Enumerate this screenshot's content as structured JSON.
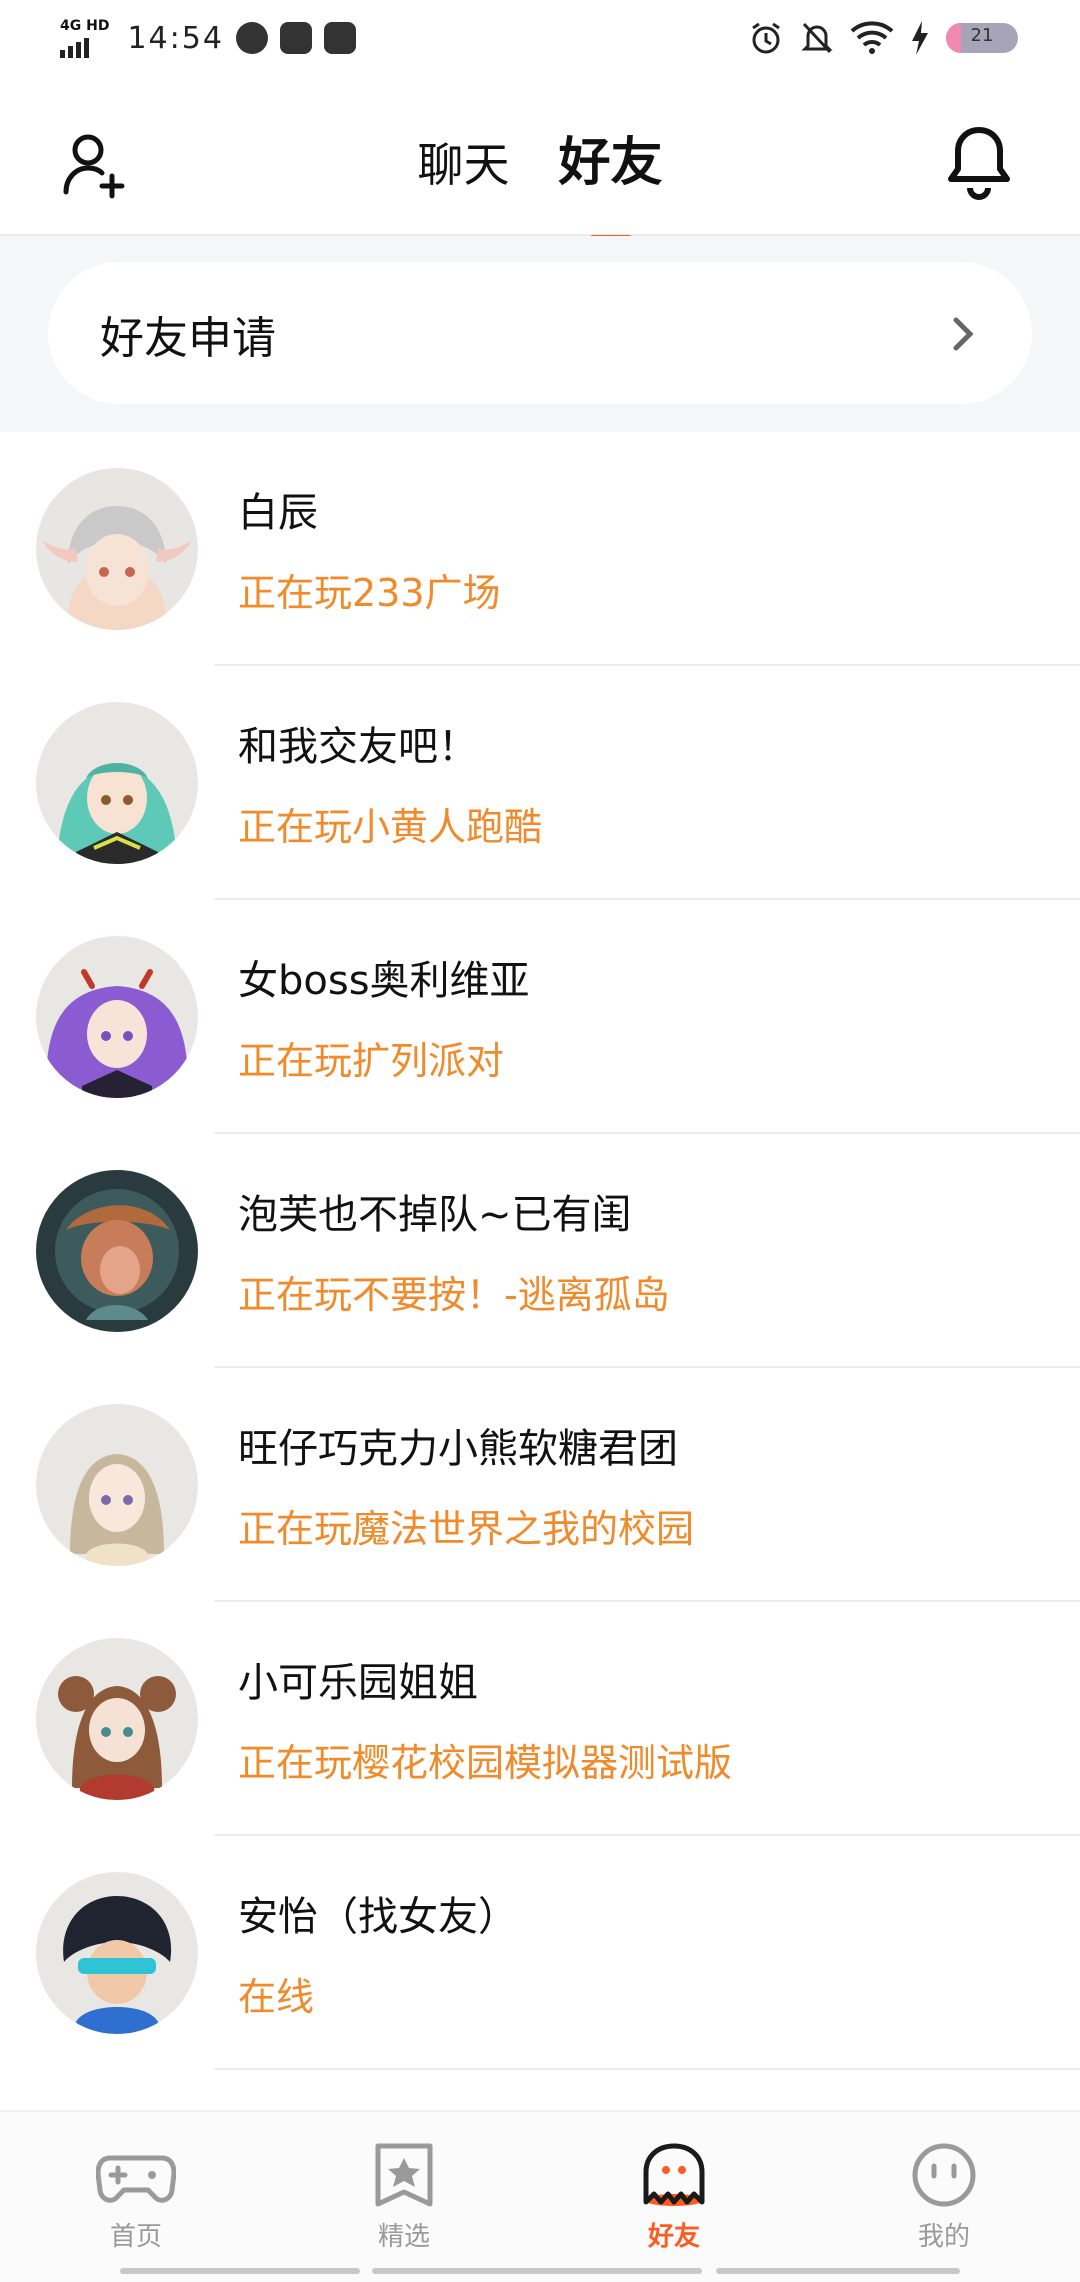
{
  "status_bar": {
    "network": "4G HD",
    "time": "14:54",
    "battery_level": "21",
    "icons": [
      "signal-icon",
      "navigation-icon",
      "video-icon",
      "mail-icon",
      "alarm-icon",
      "mute-icon",
      "wifi-icon",
      "charging-icon",
      "battery-icon"
    ]
  },
  "header": {
    "tabs": [
      {
        "label": "聊天",
        "active": false
      },
      {
        "label": "好友",
        "active": true
      }
    ],
    "left_icon": "add-friend-icon",
    "right_icon": "bell-icon",
    "accent_color": "#ff5a1f"
  },
  "friend_request": {
    "label": "好友申请"
  },
  "friends": [
    {
      "name": "白辰",
      "status": "正在玩233广场",
      "avatar_color": "#e8e6e2",
      "avatar_hair": "#c9c9c9"
    },
    {
      "name": "和我交友吧！",
      "status": "正在玩小黄人跑酷",
      "avatar_color": "#e9e7e3",
      "avatar_hair": "#5fc9b8"
    },
    {
      "name": "女boss奥利维亚",
      "status": "正在玩扩列派对",
      "avatar_color": "#e9e7e3",
      "avatar_hair": "#8a5bd1"
    },
    {
      "name": "泡芙也不掉队~已有闺",
      "status": "正在玩不要按！-逃离孤岛",
      "avatar_color": "#2a3b40",
      "avatar_hair": "#c77c5a"
    },
    {
      "name": "旺仔巧克力小熊软糖君团",
      "status": "正在玩魔法世界之我的校园",
      "avatar_color": "#e9e7e3",
      "avatar_hair": "#c7b79c"
    },
    {
      "name": "小可乐园姐姐",
      "status": "正在玩樱花校园模拟器测试版",
      "avatar_color": "#e9e7e3",
      "avatar_hair": "#8d5a3b"
    },
    {
      "name": "安怡（找女友）",
      "status": "在线",
      "avatar_color": "#e9e7e3",
      "avatar_hair": "#1f2430"
    }
  ],
  "status_color": "#f08a2a",
  "bottom_nav": [
    {
      "label": "首页",
      "icon": "gamepad-icon",
      "active": false
    },
    {
      "label": "精选",
      "icon": "star-bookmark-icon",
      "active": false
    },
    {
      "label": "好友",
      "icon": "ghost-icon",
      "active": true
    },
    {
      "label": "我的",
      "icon": "smiley-icon",
      "active": false
    }
  ]
}
